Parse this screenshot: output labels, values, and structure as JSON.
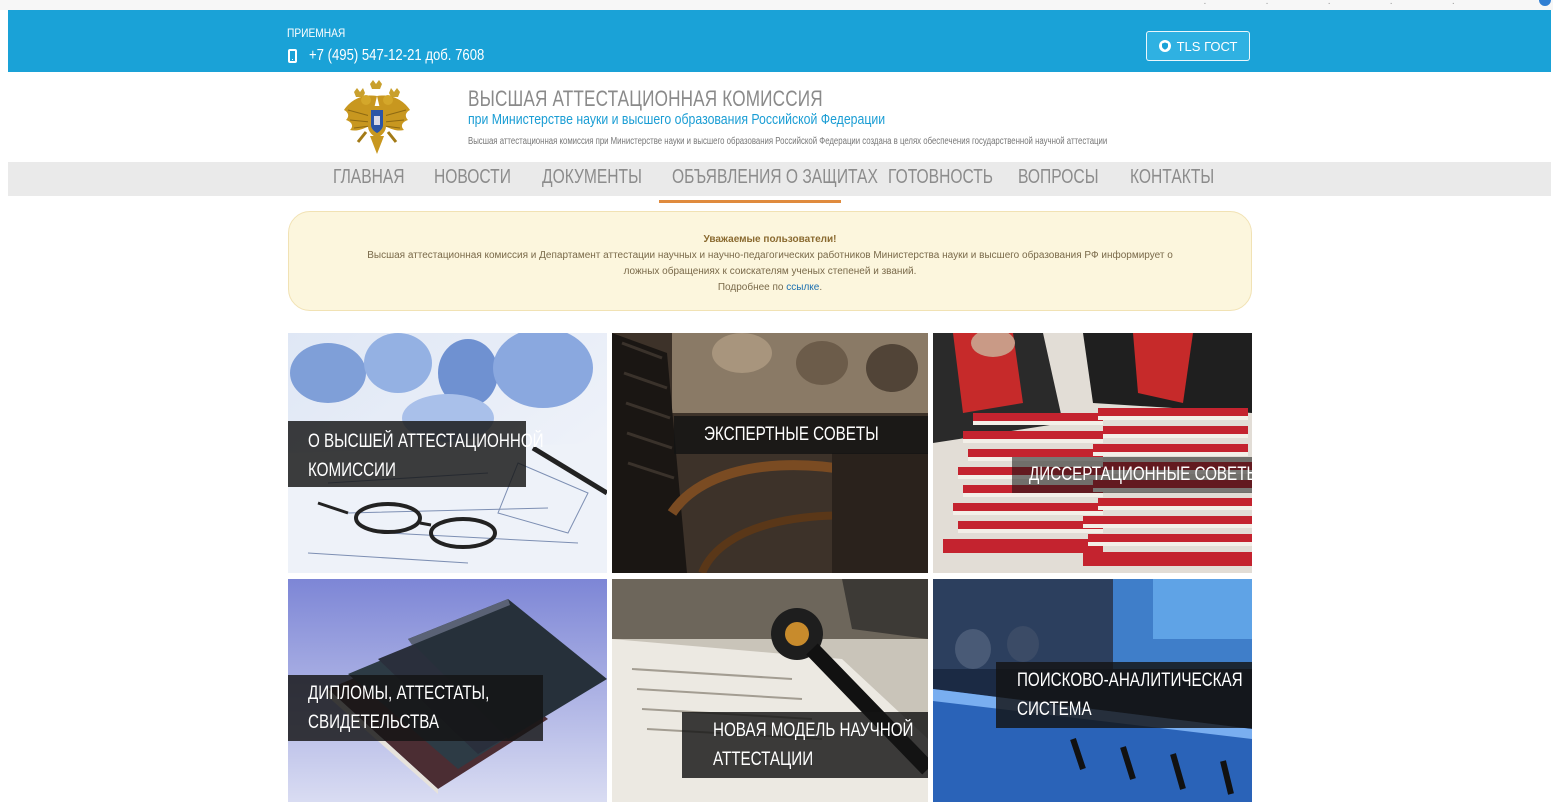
{
  "header": {
    "reception_label": "ПРИЕМНАЯ",
    "phone": "+7 (495) 547-12-21 доб. 7608",
    "tls_button": "TLS ГОСТ"
  },
  "brand": {
    "title": "ВЫСШАЯ АТТЕСТАЦИОННАЯ КОМИССИЯ",
    "subtitle": "при Министерстве науки и высшего образования Российской Федерации",
    "description": "Высшая аттестационная комиссия при Министерстве науки и высшего образования Российской Федерации создана в целях обеспечения государственной научной аттестации"
  },
  "nav": {
    "items": [
      {
        "label": "ГЛАВНАЯ"
      },
      {
        "label": "НОВОСТИ"
      },
      {
        "label": "ДОКУМЕНТЫ"
      },
      {
        "label": "ОБЪЯВЛЕНИЯ О ЗАЩИТАХ"
      },
      {
        "label": "ГОТОВНОСТЬ"
      },
      {
        "label": "ВОПРОСЫ"
      },
      {
        "label": "КОНТАКТЫ"
      }
    ],
    "active": "ОБЪЯВЛЕНИЯ О ЗАЩИТАХ"
  },
  "notice": {
    "title": "Уважаемые пользователи!",
    "line1": "Высшая аттестационная комиссия и Департамент аттестации научных и научно-педагогических работников Министерства науки и высшего образования РФ информирует о",
    "line2": "ложных обращениях к соискателям ученых степеней и званий.",
    "line3_prefix": "Подробнее по ",
    "link_text": "ссылке",
    "line3_suffix": "."
  },
  "tiles": [
    {
      "line1": "О ВЫСШЕЙ АТТЕСТАЦИОННОЙ",
      "line2": "КОМИССИИ"
    },
    {
      "line1": "ЭКСПЕРТНЫЕ СОВЕТЫ"
    },
    {
      "line1": "ДИССЕРТАЦИОННЫЕ СОВЕТЫ"
    },
    {
      "line1": "ДИПЛОМЫ, АТТЕСТАТЫ,",
      "line2": "СВИДЕТЕЛЬСТВА"
    },
    {
      "line1": "НОВАЯ МОДЕЛЬ НАУЧНОЙ",
      "line2": "АТТЕСТАЦИИ"
    },
    {
      "line1": "ПОИСКОВО-АНАЛИТИЧЕСКАЯ",
      "line2": "СИСТЕМА"
    }
  ],
  "colors": {
    "topbar": "#1aa2d7",
    "nav_bg": "#eaeaea",
    "active_underline": "#e08b3e",
    "notice_bg": "#fcf6dd"
  },
  "icons": {
    "phone": "phone-icon",
    "shield": "shield-icon",
    "emblem": "coat-of-arms-icon"
  }
}
